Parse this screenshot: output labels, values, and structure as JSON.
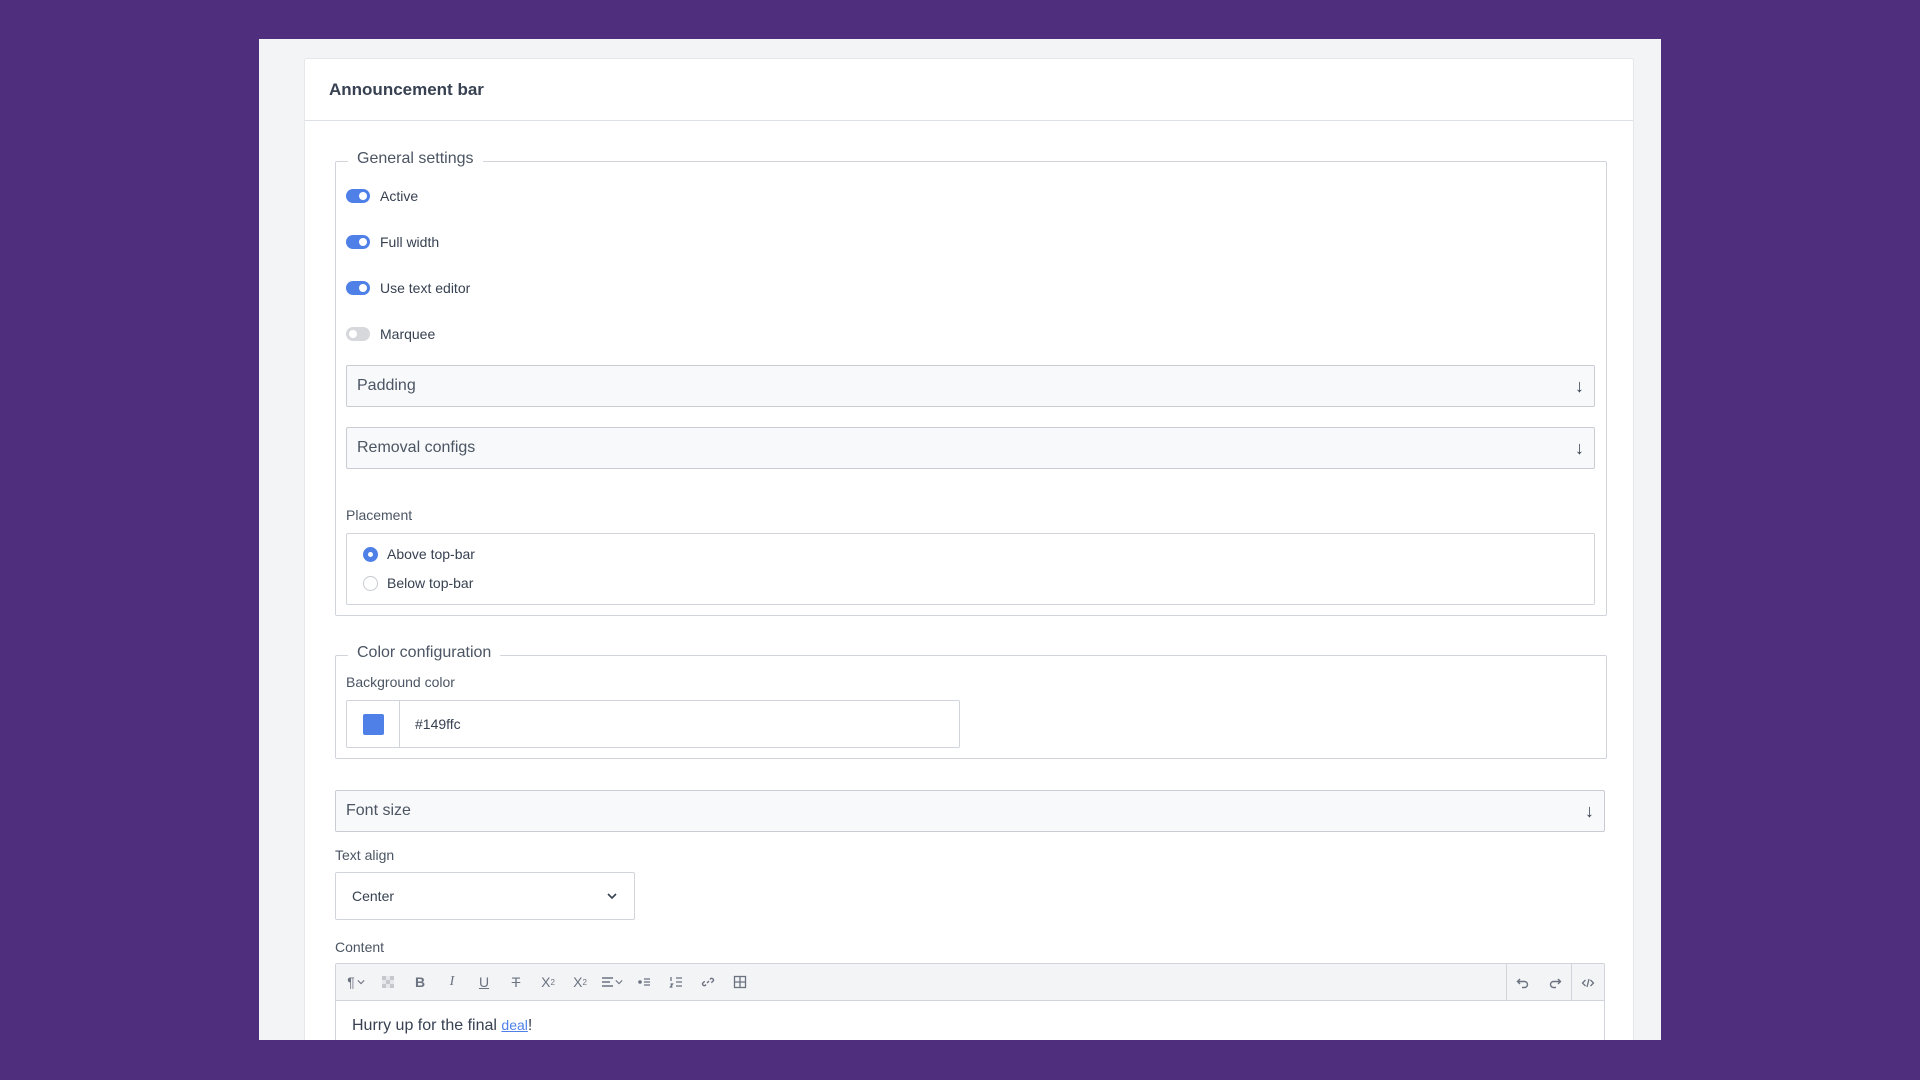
{
  "card": {
    "title": "Announcement bar"
  },
  "general": {
    "legend": "General settings",
    "toggles": [
      {
        "label": "Active",
        "on": true
      },
      {
        "label": "Full width",
        "on": true
      },
      {
        "label": "Use text editor",
        "on": true
      },
      {
        "label": "Marquee",
        "on": false
      }
    ],
    "padding_label": "Padding",
    "removal_label": "Removal configs",
    "placement": {
      "label": "Placement",
      "options": [
        {
          "label": "Above top-bar",
          "checked": true
        },
        {
          "label": "Below top-bar",
          "checked": false
        }
      ]
    }
  },
  "colors": {
    "legend": "Color configuration",
    "background_label": "Background color",
    "background_value": "#149ffc",
    "swatch_color": "#4f80e8"
  },
  "font_size_label": "Font size",
  "text_align": {
    "label": "Text align",
    "value": "Center"
  },
  "content": {
    "label": "Content",
    "text_before": "Hurry up for the final ",
    "link_text": "deal",
    "text_after": "!"
  },
  "icons": {
    "arrow": "↓",
    "paragraph": "¶"
  }
}
